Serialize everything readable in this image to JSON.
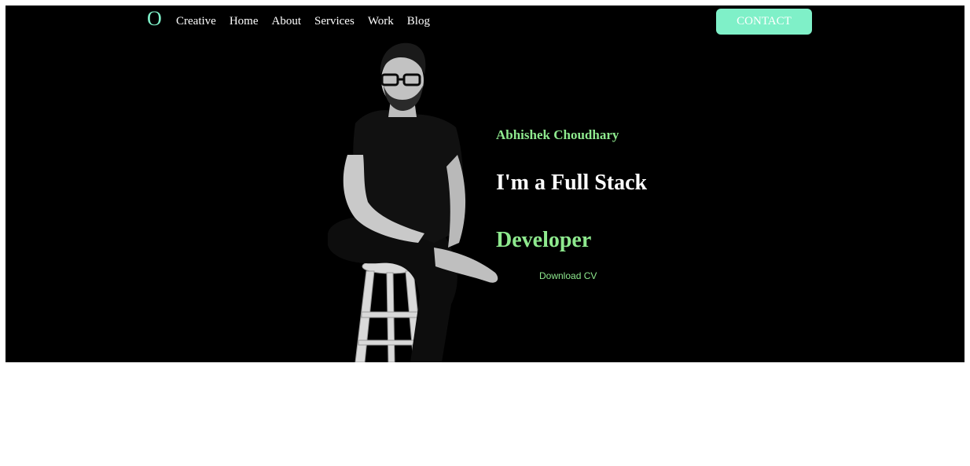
{
  "nav": {
    "logo": "O",
    "links": [
      "Creative",
      "Home",
      "About",
      "Services",
      "Work",
      "Blog"
    ],
    "contact_label": "CONTACT"
  },
  "hero": {
    "name": "Abhishek Choudhary",
    "title": "I'm a Full Stack",
    "role": "Developer",
    "download_label": "Download CV"
  },
  "colors": {
    "accent": "#7ff0c8",
    "green_text": "#8ee98e",
    "background": "#000000"
  }
}
